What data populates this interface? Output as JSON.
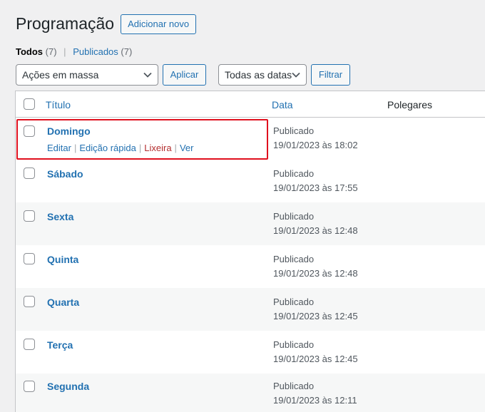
{
  "page": {
    "title": "Programação",
    "add_new_label": "Adicionar novo"
  },
  "views": {
    "all_label": "Todos",
    "all_count": "(7)",
    "published_label": "Publicados",
    "published_count": "(7)",
    "separator": "|"
  },
  "bulk": {
    "select_value": "Ações em massa",
    "apply_label": "Aplicar"
  },
  "date_filter": {
    "select_value": "Todas as datas",
    "filter_label": "Filtrar"
  },
  "table": {
    "columns": {
      "title": "Título",
      "date": "Data",
      "thumbs": "Polegares"
    },
    "row_actions": {
      "edit": "Editar",
      "quick_edit": "Edição rápida",
      "trash": "Lixeira",
      "view": "Ver",
      "sep": "|"
    },
    "rows": [
      {
        "title": "Domingo",
        "status": "Publicado",
        "date": "19/01/2023 às 18:02"
      },
      {
        "title": "Sábado",
        "status": "Publicado",
        "date": "19/01/2023 às 17:55"
      },
      {
        "title": "Sexta",
        "status": "Publicado",
        "date": "19/01/2023 às 12:48"
      },
      {
        "title": "Quinta",
        "status": "Publicado",
        "date": "19/01/2023 às 12:48"
      },
      {
        "title": "Quarta",
        "status": "Publicado",
        "date": "19/01/2023 às 12:45"
      },
      {
        "title": "Terça",
        "status": "Publicado",
        "date": "19/01/2023 às 12:45"
      },
      {
        "title": "Segunda",
        "status": "Publicado",
        "date": "19/01/2023 às 12:11"
      }
    ]
  },
  "colors": {
    "accent": "#2271b1",
    "trash": "#b32d2e",
    "highlight": "#e0101e",
    "background": "#f0f0f1"
  }
}
